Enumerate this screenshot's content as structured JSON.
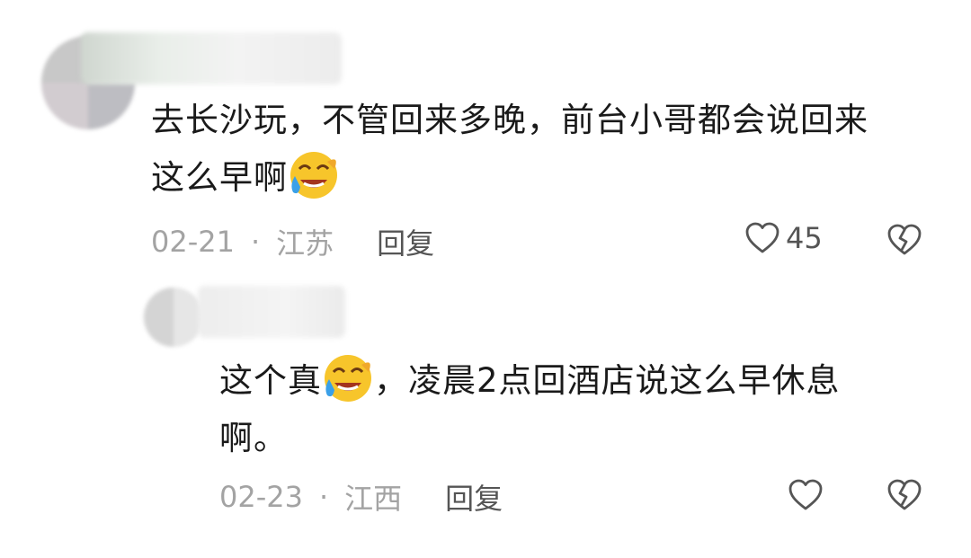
{
  "comments": [
    {
      "text_line1": "去长沙玩，不管回来多晚，前台小哥都会说回来",
      "text_line2": "这么早啊",
      "emoji": "laugh-cry-emoji",
      "date": "02-21",
      "separator": "·",
      "location": "江苏",
      "reply_label": "回复",
      "like_count": "45"
    },
    {
      "text_line1_a": "这个真",
      "emoji": "laugh-cry-emoji",
      "text_line1_b": "，凌晨2点回酒店说这么早休息",
      "text_line2": "啊。",
      "date": "02-23",
      "separator": "·",
      "location": "江西",
      "reply_label": "回复",
      "like_count": ""
    }
  ],
  "colors": {
    "text": "#1a1a1a",
    "meta": "#a3a3a3",
    "icon": "#555555",
    "emoji_face": "#f7c52b",
    "emoji_tear": "#3aa0e8"
  },
  "icons": [
    "heart-icon",
    "broken-heart-icon"
  ]
}
